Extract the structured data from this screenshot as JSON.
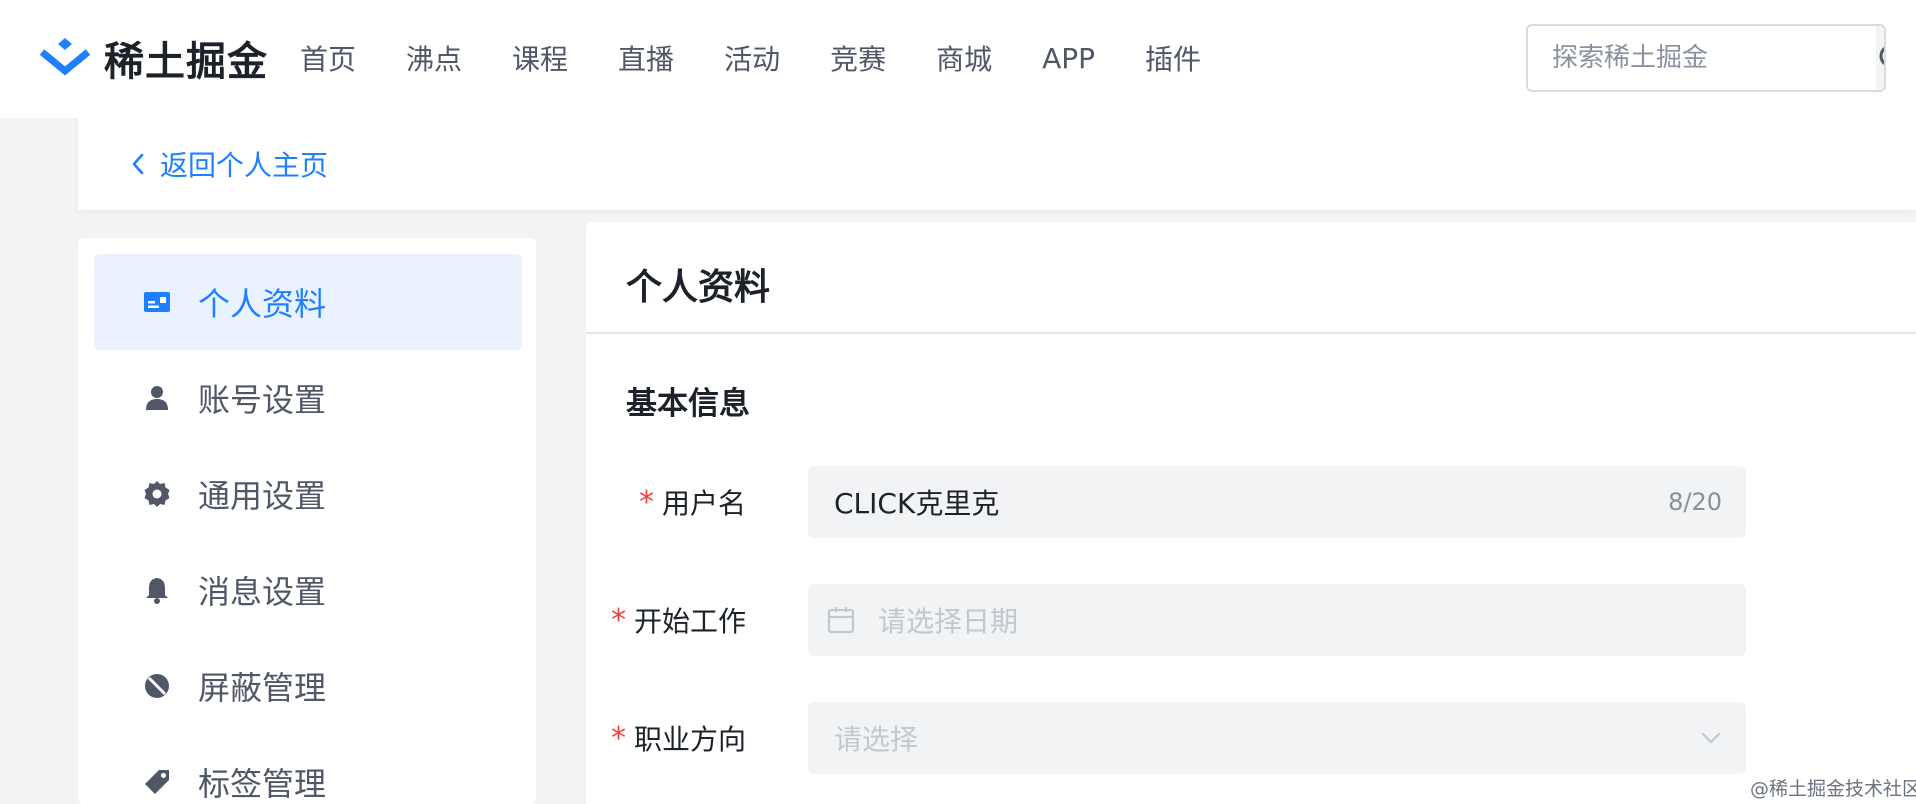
{
  "header": {
    "logo_text": "稀土掘金",
    "nav": [
      "首页",
      "沸点",
      "课程",
      "直播",
      "活动",
      "竞赛",
      "商城",
      "APP",
      "插件"
    ],
    "search_placeholder": "探索稀土掘金"
  },
  "back": {
    "label": "返回个人主页"
  },
  "sidebar": {
    "items": [
      {
        "label": "个人资料",
        "icon": "profile-card-icon",
        "active": true
      },
      {
        "label": "账号设置",
        "icon": "user-icon"
      },
      {
        "label": "通用设置",
        "icon": "gear-icon"
      },
      {
        "label": "消息设置",
        "icon": "bell-icon"
      },
      {
        "label": "屏蔽管理",
        "icon": "block-icon"
      },
      {
        "label": "标签管理",
        "icon": "tag-icon"
      }
    ]
  },
  "main": {
    "title": "个人资料",
    "section_title": "基本信息",
    "fields": {
      "username": {
        "label": "用户名",
        "value": "CLICK克里克",
        "counter": "8/20"
      },
      "start_work": {
        "label": "开始工作",
        "placeholder": "请选择日期"
      },
      "career": {
        "label": "职业方向",
        "placeholder": "请选择"
      }
    }
  },
  "colors": {
    "accent": "#1e80ff",
    "required": "#f53f3f",
    "background": "#f2f3f5"
  },
  "watermark": "@稀土掘金技术社区"
}
